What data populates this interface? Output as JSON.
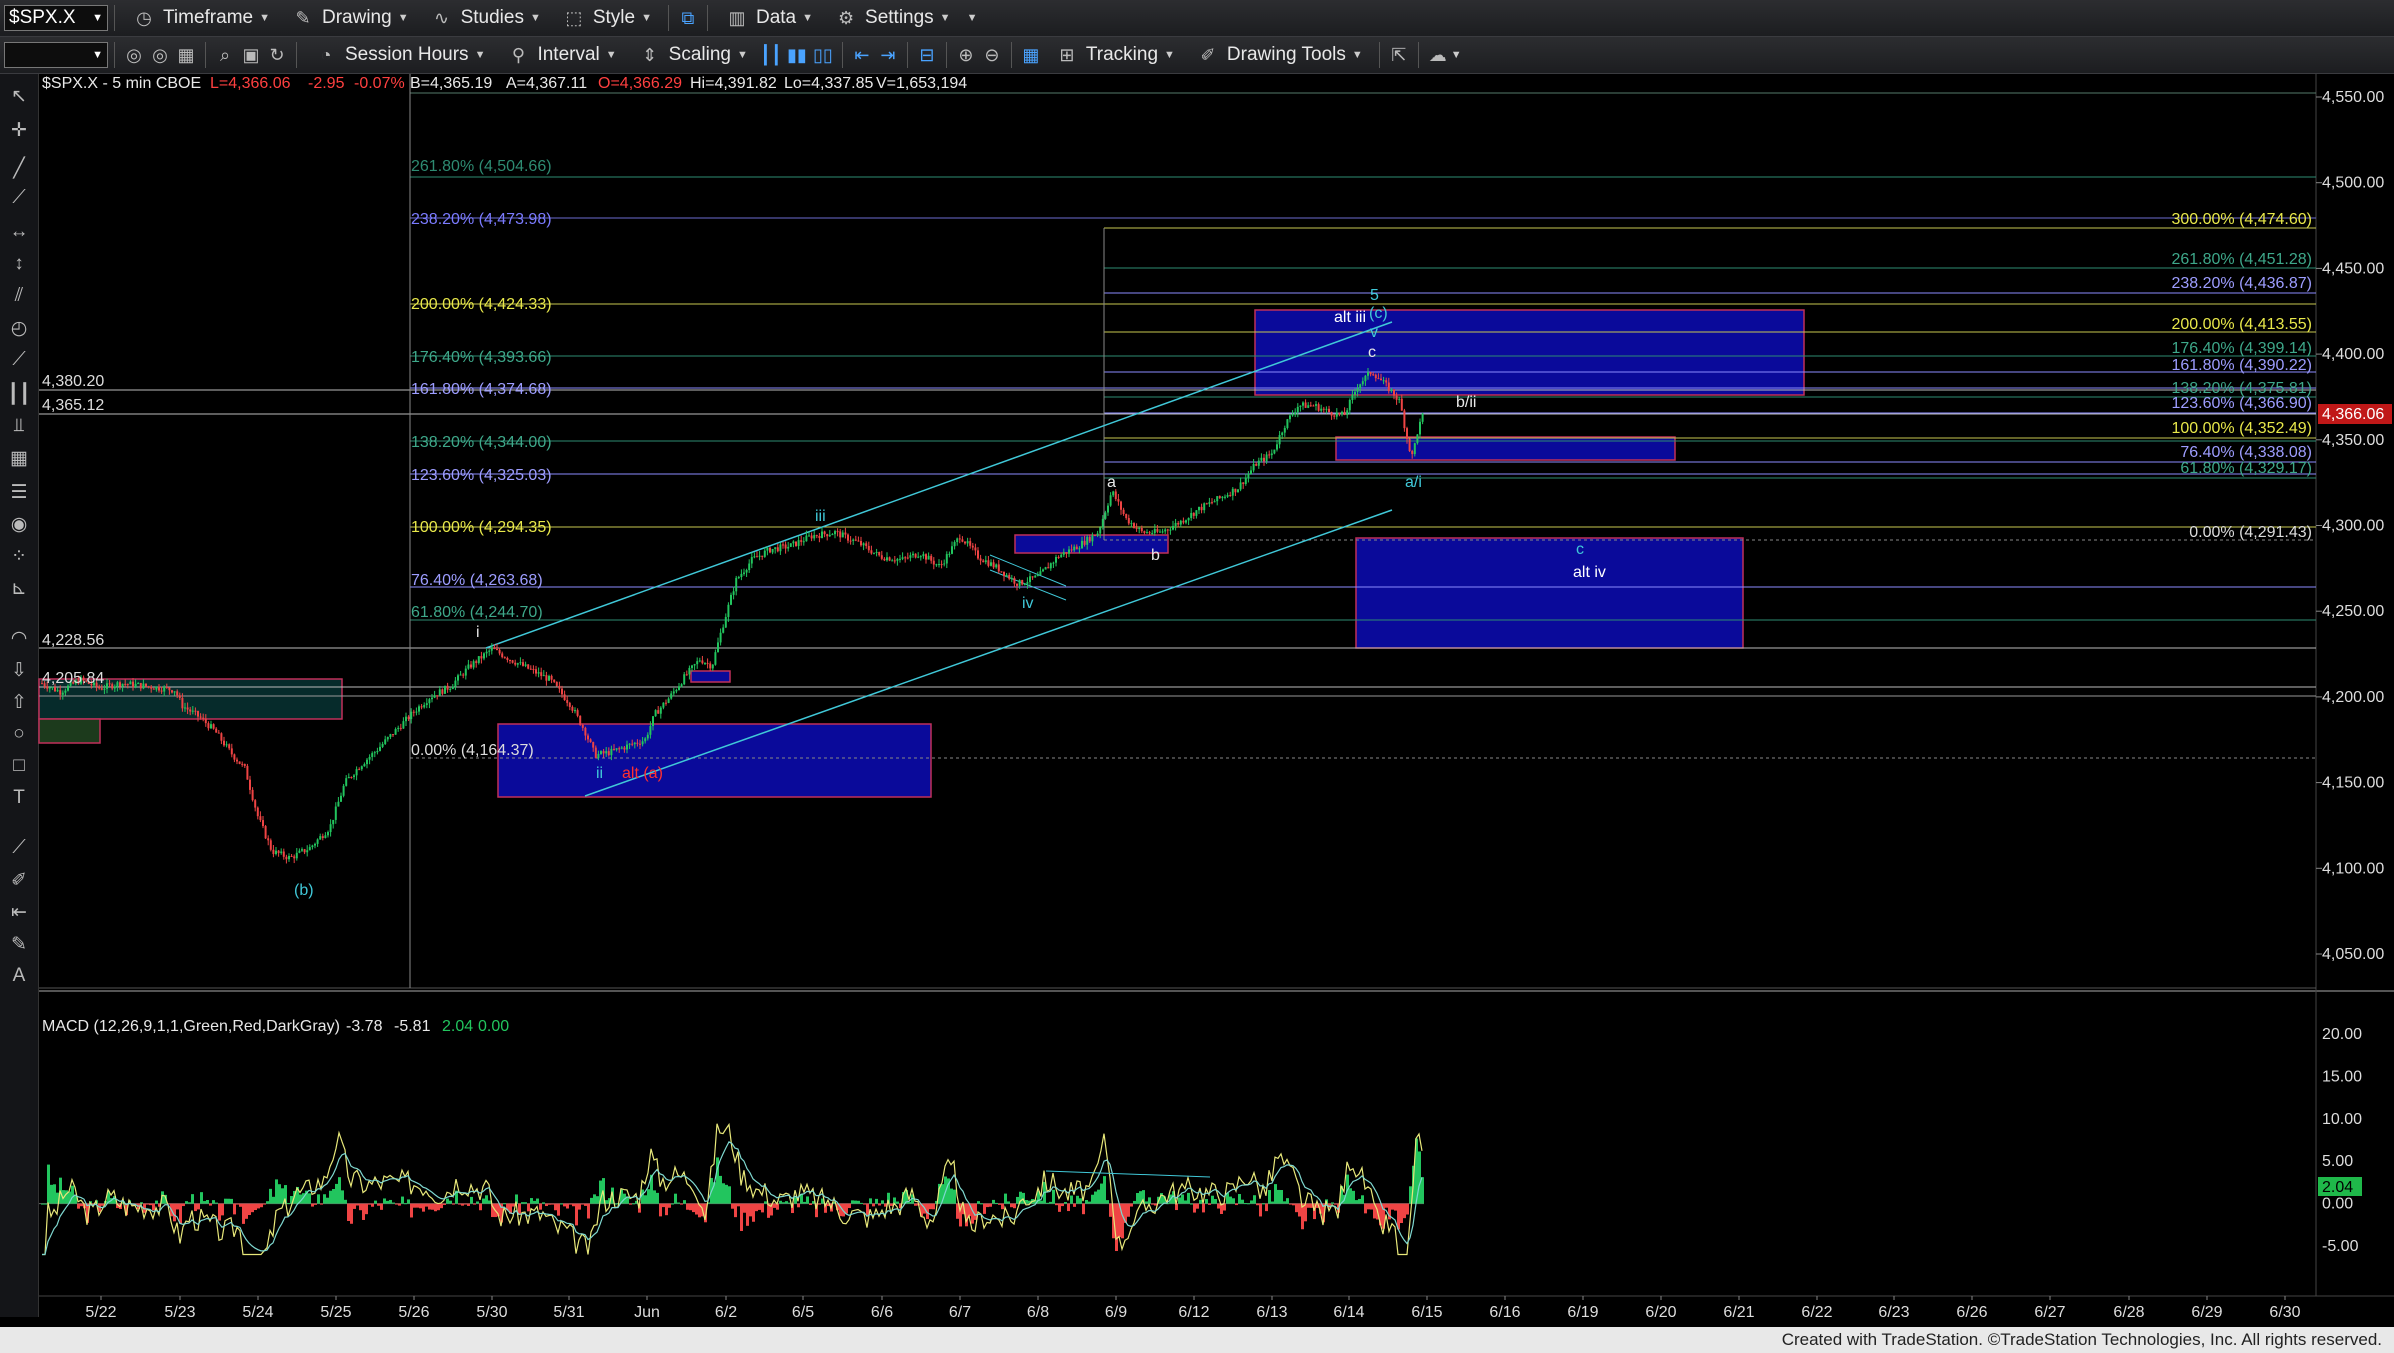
{
  "toolbar1": {
    "symbol": "$SPX.X",
    "timeframe": "Timeframe",
    "drawing": "Drawing",
    "studies": "Studies",
    "style": "Style",
    "data": "Data",
    "settings": "Settings"
  },
  "toolbar2": {
    "session_hours": "Session Hours",
    "interval": "Interval",
    "scaling": "Scaling",
    "tracking": "Tracking",
    "drawing_tools": "Drawing Tools"
  },
  "header": {
    "symbol_desc": "$SPX.X - 5 min  CBOE",
    "last": "L=4,366.06",
    "change": "-2.95",
    "pct": "-0.07%",
    "bid": "B=4,365.19",
    "ask": "A=4,367.11",
    "open": "O=4,366.29",
    "high": "Hi=4,391.82",
    "low": "Lo=4,337.85",
    "volume": "V=1,653,194"
  },
  "price_axis": {
    "ticks": [
      "4,550.00",
      "4,500.00",
      "4,450.00",
      "4,400.00",
      "4,350.00",
      "4,300.00",
      "4,250.00",
      "4,200.00",
      "4,150.00",
      "4,100.00",
      "4,050.00"
    ],
    "last_label": "4,366.06"
  },
  "macd_axis": {
    "ticks": [
      "20.00",
      "15.00",
      "10.00",
      "5.00",
      "0.00",
      "-5.00"
    ],
    "last_label": "2.04"
  },
  "date_axis": [
    "5/22",
    "5/23",
    "5/24",
    "5/25",
    "5/26",
    "5/30",
    "5/31",
    "Jun",
    "6/2",
    "6/5",
    "6/6",
    "6/7",
    "6/8",
    "6/9",
    "6/12",
    "6/13",
    "6/14",
    "6/15",
    "6/16",
    "6/19",
    "6/20",
    "6/21",
    "6/22",
    "6/23",
    "6/26",
    "6/27",
    "6/28",
    "6/29",
    "6/30"
  ],
  "level_labels": {
    "l4380": "4,380.20",
    "l4365": "4,365.12",
    "l4228": "4,228.56",
    "l4205": "4,205.84"
  },
  "fib_left": [
    {
      "text": "261.80% (4,504.66)",
      "color": "#2e8b72"
    },
    {
      "text": "238.20% (4,473.98)",
      "color": "#7b7bff"
    },
    {
      "text": "200.00% (4,424.33)",
      "color": "#e8e84a"
    },
    {
      "text": "176.40% (4,393.66)",
      "color": "#3ea88a"
    },
    {
      "text": "161.80% (4,374.68)",
      "color": "#9d9dff"
    },
    {
      "text": "138.20% (4,344.00)",
      "color": "#3ea88a"
    },
    {
      "text": "123.60% (4,325.03)",
      "color": "#9d9dff"
    },
    {
      "text": "100.00% (4,294.35)",
      "color": "#e8e84a"
    },
    {
      "text": "76.40% (4,263.68)",
      "color": "#9d9dff"
    },
    {
      "text": "61.80% (4,244.70)",
      "color": "#3ea88a"
    },
    {
      "text": "0.00% (4,164.37)",
      "color": "#dddddd"
    }
  ],
  "fib_right": [
    {
      "text": "300.00% (4,474.60)",
      "color": "#e8e84a"
    },
    {
      "text": "261.80% (4,451.28)",
      "color": "#3ea88a"
    },
    {
      "text": "238.20% (4,436.87)",
      "color": "#9d9dff"
    },
    {
      "text": "200.00% (4,413.55)",
      "color": "#e8e84a"
    },
    {
      "text": "176.40% (4,399.14)",
      "color": "#3ea88a"
    },
    {
      "text": "161.80% (4,390.22)",
      "color": "#9d9dff"
    },
    {
      "text": "138.20% (4,375.81)",
      "color": "#3ea88a"
    },
    {
      "text": "123.60% (4,366.90)",
      "color": "#9d9dff"
    },
    {
      "text": "100.00% (4,352.49)",
      "color": "#e8e84a"
    },
    {
      "text": "76.40% (4,338.08)",
      "color": "#9d9dff"
    },
    {
      "text": "61.80% (4,329.17)",
      "color": "#3ea88a"
    },
    {
      "text": "0.00% (4,291.43)",
      "color": "#dddddd"
    }
  ],
  "wave_labels": {
    "b_paren": "(b)",
    "i": "i",
    "ii": "ii",
    "alt_a": "alt (a)",
    "iii": "iii",
    "iv": "iv",
    "a": "a",
    "b": "b",
    "five": "5",
    "alt_iii": "alt iii",
    "c_paren": "(c)",
    "v": "v",
    "c_top": "c",
    "b_ii": "b/ii",
    "a_i": "a/i",
    "c_low": "c",
    "alt_iv": "alt iv"
  },
  "macd": {
    "title": "MACD (12,26,9,1,1,Green,Red,DarkGray)",
    "v1": "-3.78",
    "v2": "-5.81",
    "v3": "2.04",
    "v4": "0.00"
  },
  "colors": {
    "up_candle": "#22c55e",
    "down_candle": "#ef4444",
    "zone_blue": "#0a0a9a",
    "zone_border": "#c0305a",
    "teal": "#40c8d8"
  },
  "footer": "Created with TradeStation. ©TradeStation Technologies, Inc. All rights reserved."
}
